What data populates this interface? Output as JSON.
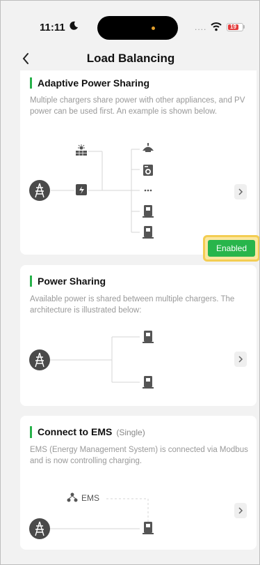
{
  "status": {
    "time": "11:11",
    "signal": "....",
    "battery": "19",
    "battery_color": "#e23b3b"
  },
  "nav": {
    "title": "Load Balancing",
    "back_icon": "chevron-left-icon"
  },
  "accent_color": "#27b14a",
  "cards": [
    {
      "title": "Adaptive Power Sharing",
      "description": "Multiple chargers share power with other appliances, and PV power can be used first. An example is shown below.",
      "status_button": "Enabled",
      "diagram": {
        "nodes": [
          "grid-tower-icon",
          "solar-panel-icon",
          "inverter-icon",
          "lamp-icon",
          "washing-machine-icon",
          "more-icon",
          "charger-icon",
          "charger-icon"
        ],
        "more_label": "..."
      }
    },
    {
      "title": "Power Sharing",
      "description": "Available power is shared between multiple chargers. The architecture is illustrated below:",
      "diagram": {
        "nodes": [
          "grid-tower-icon",
          "charger-icon",
          "charger-icon"
        ]
      }
    },
    {
      "title": "Connect to EMS",
      "subtitle": "(Single)",
      "description": "EMS (Energy Management System) is connected via Modbus and is now controlling charging.",
      "diagram": {
        "ems_label": "EMS",
        "nodes": [
          "grid-tower-icon",
          "ems-network-icon",
          "charger-icon"
        ]
      }
    }
  ]
}
